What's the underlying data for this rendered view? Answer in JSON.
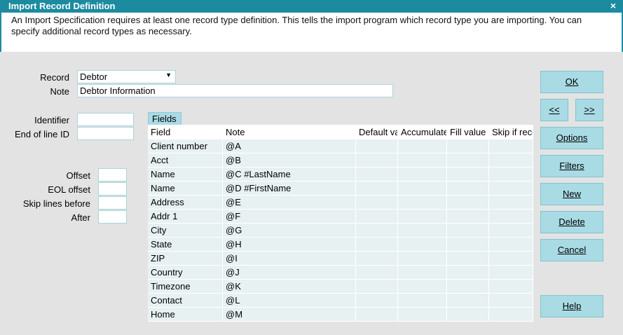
{
  "window": {
    "title": "Import Record Definition",
    "close_glyph": "×"
  },
  "description": "An Import Specification requires at least one record type definition. This tells the import program which record type you are importing. You can specify additional record types as necessary.",
  "form": {
    "record_label": "Record",
    "record_value": "Debtor",
    "note_label": "Note",
    "note_value": "Debtor Information",
    "identifier_label": "Identifier",
    "identifier_value": "",
    "eol_id_label": "End of line ID",
    "eol_id_value": "",
    "offset_label": "Offset",
    "offset_value": "",
    "eol_offset_label": "EOL offset",
    "eol_offset_value": "",
    "skip_before_label": "Skip lines before",
    "skip_before_value": "",
    "after_label": "After",
    "after_value": ""
  },
  "fields_tab": "Fields",
  "grid": {
    "columns": [
      "Field",
      "Note",
      "Default value",
      "Accumulate",
      "Fill value",
      "Skip if record"
    ],
    "rows": [
      [
        "Client number",
        "@A"
      ],
      [
        "Acct",
        "@B"
      ],
      [
        "Name",
        "@C #LastName"
      ],
      [
        "Name",
        "@D #FirstName"
      ],
      [
        "Address",
        "@E"
      ],
      [
        "Addr 1",
        "@F"
      ],
      [
        "City",
        "@G"
      ],
      [
        "State",
        "@H"
      ],
      [
        "ZIP",
        "@I"
      ],
      [
        "Country",
        "@J"
      ],
      [
        "Timezone",
        "@K"
      ],
      [
        "Contact",
        "@L"
      ],
      [
        "Home",
        "@M"
      ]
    ]
  },
  "buttons": {
    "ok": "OK",
    "prev": "<<",
    "next": ">>",
    "options": "Options",
    "filters": "Filters",
    "new": "New",
    "delete": "Delete",
    "cancel": "Cancel",
    "help": "Help"
  },
  "colors": {
    "titlebar": "#1c8ba0",
    "button": "#a9dbe4",
    "background": "#e3e3e3"
  }
}
